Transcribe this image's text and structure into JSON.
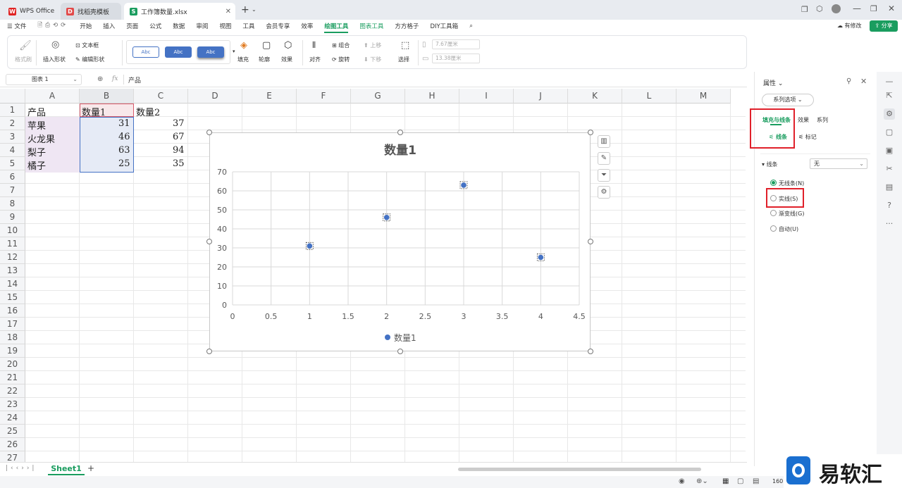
{
  "titlebar": {
    "tabs": [
      {
        "label": "WPS Office",
        "logo": "W",
        "color": "#e02424"
      },
      {
        "label": "找稻壳模板",
        "logo": "D",
        "color": "#e24a4a"
      },
      {
        "label": "工作簿数量.xlsx",
        "logo": "S",
        "color": "#1a9d5f"
      }
    ]
  },
  "menu": {
    "file": "文件",
    "items": [
      "开始",
      "插入",
      "页面",
      "公式",
      "数据",
      "审阅",
      "视图",
      "工具",
      "会员专享",
      "效率",
      "绘图工具",
      "图表工具",
      "方方格子",
      "DIY工具箱"
    ],
    "active": "绘图工具",
    "modified": "有修改",
    "share": "分享"
  },
  "ribbon": {
    "format_painter": "格式刷",
    "insert_shape": "插入形状",
    "textbox": "文本框",
    "edit_shape": "编辑形状",
    "style_sample": "Abc",
    "fill": "填充",
    "outline": "轮廓",
    "effect": "效果",
    "align": "对齐",
    "group": "组合",
    "rotate": "旋转",
    "up": "上移",
    "down": "下移",
    "select": "选择",
    "width": "7.67厘米",
    "height": "13.38厘米"
  },
  "formula": {
    "namebox": "图表 1",
    "fx": "fx",
    "content": "产品"
  },
  "grid": {
    "columns": [
      "A",
      "B",
      "C",
      "D",
      "E",
      "F",
      "G",
      "H",
      "I",
      "J",
      "K",
      "L",
      "M"
    ],
    "rows": [
      "1",
      "2",
      "3",
      "4",
      "5",
      "6",
      "7",
      "8",
      "9",
      "10",
      "11",
      "12",
      "13",
      "14",
      "15",
      "16",
      "17",
      "18",
      "19",
      "20",
      "21",
      "22",
      "23",
      "24",
      "25",
      "26",
      "27"
    ],
    "cells": {
      "a1": "产品",
      "b1": "数量1",
      "c1": "数量2",
      "a2": "苹果",
      "b2": "31",
      "c2": "37",
      "a3": "火龙果",
      "b3": "46",
      "c3": "67",
      "a4": "梨子",
      "b4": "63",
      "c4": "94",
      "a5": "橘子",
      "b5": "25",
      "c5": "35"
    }
  },
  "chart_data": {
    "type": "scatter",
    "title": "数量1",
    "series": [
      {
        "name": "数量1",
        "x": [
          1,
          2,
          3,
          4
        ],
        "values": [
          31,
          46,
          63,
          25
        ],
        "color": "#4472c4"
      }
    ],
    "xlim": [
      0,
      4.5
    ],
    "ylim": [
      0,
      70
    ],
    "xticks": [
      "0",
      "0.5",
      "1",
      "1.5",
      "2",
      "2.5",
      "3",
      "3.5",
      "4",
      "4.5"
    ],
    "yticks": [
      "0",
      "10",
      "20",
      "30",
      "40",
      "50",
      "60",
      "70"
    ],
    "grid": true,
    "legend": "bottom"
  },
  "panel": {
    "title": "属性",
    "series_options": "系列选项",
    "tabs": [
      "填充与线条",
      "效果",
      "系列"
    ],
    "subtabs": [
      "线条",
      "标记"
    ],
    "section": "线条",
    "dropdown_value": "无",
    "options": [
      "无线条(N)",
      "实线(S)",
      "渐变线(G)",
      "自动(U)"
    ],
    "selected": 0
  },
  "sheetbar": {
    "sheet": "Sheet1",
    "add": "+"
  },
  "status": {
    "zoom": "160"
  },
  "watermark": "易软汇",
  "colors": {
    "accent": "#1a9d5f",
    "series": "#4472c4",
    "highlight": "#e0202a"
  }
}
